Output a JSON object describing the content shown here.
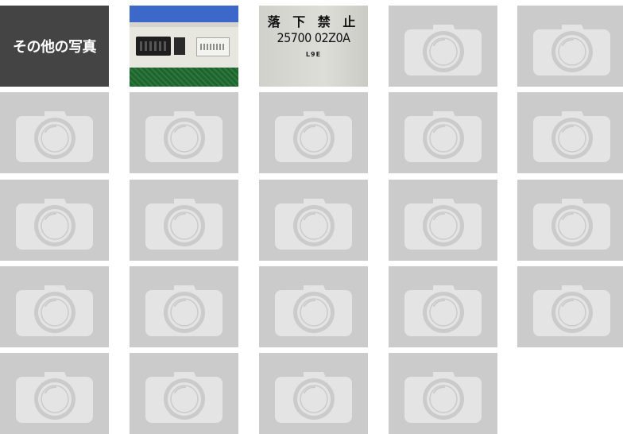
{
  "header_tile": {
    "label": "その他の写真"
  },
  "photos": [
    {
      "kind": "ecu-module-photo"
    },
    {
      "kind": "label-photo",
      "lines": [
        "落 下 禁 止",
        "25700 02Z0A",
        "L9E"
      ]
    }
  ],
  "placeholder": {
    "icon": "camera-icon",
    "count": 21
  },
  "colors": {
    "header_bg": "#444444",
    "placeholder_bg": "#cbcbcb",
    "placeholder_icon": "#e4e4e4",
    "icon_stroke": "#cbcbcb"
  }
}
